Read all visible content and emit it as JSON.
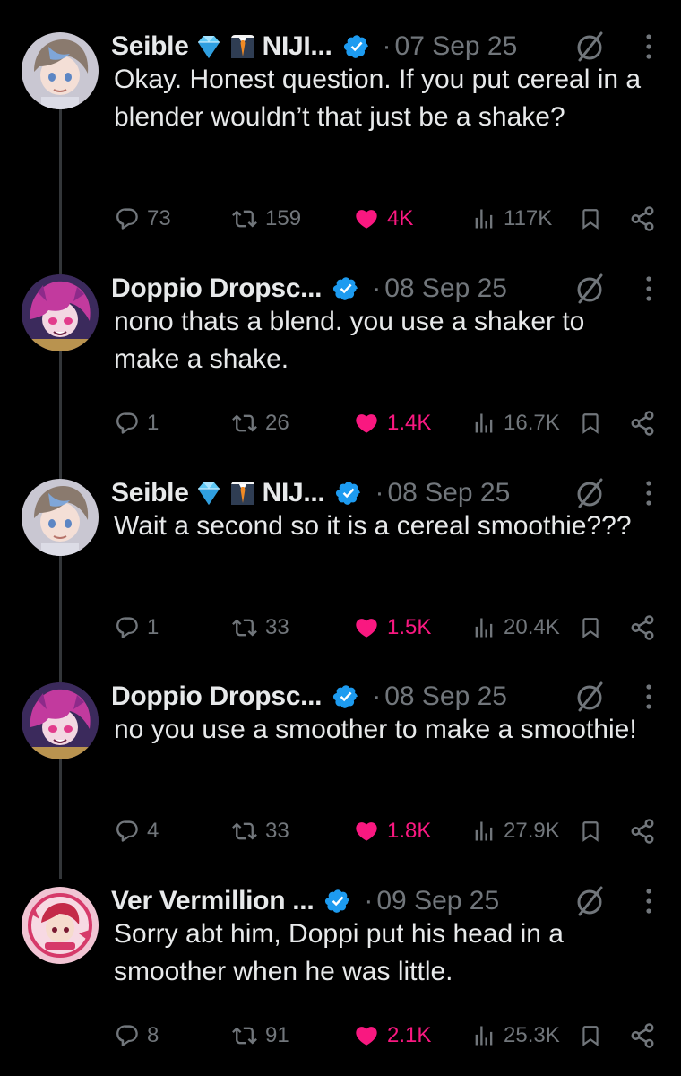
{
  "tweets": [
    {
      "name": "Seible",
      "date": "07 Sep 25",
      "text": "Okay. Honest question. If you put cereal in a blender wouldn’t that just be a shake?",
      "replies": "73",
      "retweets": "159",
      "likes": "4K",
      "views": "117K",
      "name_suffix": "NIJI...",
      "emojis": [
        "gem-icon",
        "suit-tie-icon"
      ],
      "avatar": "seible"
    },
    {
      "name": "Doppio Dropsc...",
      "date": "08 Sep 25",
      "text": "nono thats a blend. you use a shaker to make a shake.",
      "replies": "1",
      "retweets": "26",
      "likes": "1.4K",
      "views": "16.7K",
      "avatar": "doppio"
    },
    {
      "name": "Seible",
      "date": "08 Sep 25",
      "text": "Wait a second so it is a cereal smoothie???",
      "replies": "1",
      "retweets": "33",
      "likes": "1.5K",
      "views": "20.4K",
      "name_suffix": "NIJ...",
      "emojis": [
        "gem-icon",
        "suit-tie-icon"
      ],
      "avatar": "seible"
    },
    {
      "name": "Doppio Dropsc...",
      "date": "08 Sep 25",
      "text": "no you use a smoother to make a smoothie!",
      "replies": "4",
      "retweets": "33",
      "likes": "1.8K",
      "views": "27.9K",
      "avatar": "doppio"
    },
    {
      "name": "Ver Vermillion ...",
      "date": "09 Sep 25",
      "text": "Sorry abt him, Doppi put his head in a smoother when he was little.",
      "replies": "8",
      "retweets": "91",
      "likes": "2.1K",
      "views": "25.3K",
      "avatar": "ver"
    }
  ],
  "colors": {
    "background": "#000000",
    "text": "#e7e9ea",
    "muted": "#71767b",
    "like": "#f91880",
    "verified": "#1d9bf0",
    "thread_line": "#333639"
  },
  "separator": "·"
}
